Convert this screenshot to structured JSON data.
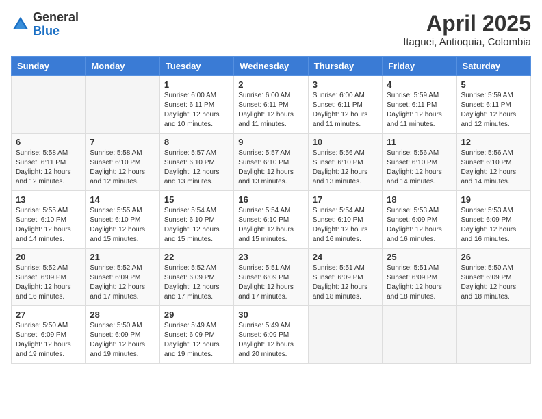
{
  "header": {
    "logo_general": "General",
    "logo_blue": "Blue",
    "month_year": "April 2025",
    "location": "Itaguei, Antioquia, Colombia"
  },
  "weekdays": [
    "Sunday",
    "Monday",
    "Tuesday",
    "Wednesday",
    "Thursday",
    "Friday",
    "Saturday"
  ],
  "weeks": [
    [
      {
        "day": "",
        "info": ""
      },
      {
        "day": "",
        "info": ""
      },
      {
        "day": "1",
        "info": "Sunrise: 6:00 AM\nSunset: 6:11 PM\nDaylight: 12 hours\nand 10 minutes."
      },
      {
        "day": "2",
        "info": "Sunrise: 6:00 AM\nSunset: 6:11 PM\nDaylight: 12 hours\nand 11 minutes."
      },
      {
        "day": "3",
        "info": "Sunrise: 6:00 AM\nSunset: 6:11 PM\nDaylight: 12 hours\nand 11 minutes."
      },
      {
        "day": "4",
        "info": "Sunrise: 5:59 AM\nSunset: 6:11 PM\nDaylight: 12 hours\nand 11 minutes."
      },
      {
        "day": "5",
        "info": "Sunrise: 5:59 AM\nSunset: 6:11 PM\nDaylight: 12 hours\nand 12 minutes."
      }
    ],
    [
      {
        "day": "6",
        "info": "Sunrise: 5:58 AM\nSunset: 6:11 PM\nDaylight: 12 hours\nand 12 minutes."
      },
      {
        "day": "7",
        "info": "Sunrise: 5:58 AM\nSunset: 6:10 PM\nDaylight: 12 hours\nand 12 minutes."
      },
      {
        "day": "8",
        "info": "Sunrise: 5:57 AM\nSunset: 6:10 PM\nDaylight: 12 hours\nand 13 minutes."
      },
      {
        "day": "9",
        "info": "Sunrise: 5:57 AM\nSunset: 6:10 PM\nDaylight: 12 hours\nand 13 minutes."
      },
      {
        "day": "10",
        "info": "Sunrise: 5:56 AM\nSunset: 6:10 PM\nDaylight: 12 hours\nand 13 minutes."
      },
      {
        "day": "11",
        "info": "Sunrise: 5:56 AM\nSunset: 6:10 PM\nDaylight: 12 hours\nand 14 minutes."
      },
      {
        "day": "12",
        "info": "Sunrise: 5:56 AM\nSunset: 6:10 PM\nDaylight: 12 hours\nand 14 minutes."
      }
    ],
    [
      {
        "day": "13",
        "info": "Sunrise: 5:55 AM\nSunset: 6:10 PM\nDaylight: 12 hours\nand 14 minutes."
      },
      {
        "day": "14",
        "info": "Sunrise: 5:55 AM\nSunset: 6:10 PM\nDaylight: 12 hours\nand 15 minutes."
      },
      {
        "day": "15",
        "info": "Sunrise: 5:54 AM\nSunset: 6:10 PM\nDaylight: 12 hours\nand 15 minutes."
      },
      {
        "day": "16",
        "info": "Sunrise: 5:54 AM\nSunset: 6:10 PM\nDaylight: 12 hours\nand 15 minutes."
      },
      {
        "day": "17",
        "info": "Sunrise: 5:54 AM\nSunset: 6:10 PM\nDaylight: 12 hours\nand 16 minutes."
      },
      {
        "day": "18",
        "info": "Sunrise: 5:53 AM\nSunset: 6:09 PM\nDaylight: 12 hours\nand 16 minutes."
      },
      {
        "day": "19",
        "info": "Sunrise: 5:53 AM\nSunset: 6:09 PM\nDaylight: 12 hours\nand 16 minutes."
      }
    ],
    [
      {
        "day": "20",
        "info": "Sunrise: 5:52 AM\nSunset: 6:09 PM\nDaylight: 12 hours\nand 16 minutes."
      },
      {
        "day": "21",
        "info": "Sunrise: 5:52 AM\nSunset: 6:09 PM\nDaylight: 12 hours\nand 17 minutes."
      },
      {
        "day": "22",
        "info": "Sunrise: 5:52 AM\nSunset: 6:09 PM\nDaylight: 12 hours\nand 17 minutes."
      },
      {
        "day": "23",
        "info": "Sunrise: 5:51 AM\nSunset: 6:09 PM\nDaylight: 12 hours\nand 17 minutes."
      },
      {
        "day": "24",
        "info": "Sunrise: 5:51 AM\nSunset: 6:09 PM\nDaylight: 12 hours\nand 18 minutes."
      },
      {
        "day": "25",
        "info": "Sunrise: 5:51 AM\nSunset: 6:09 PM\nDaylight: 12 hours\nand 18 minutes."
      },
      {
        "day": "26",
        "info": "Sunrise: 5:50 AM\nSunset: 6:09 PM\nDaylight: 12 hours\nand 18 minutes."
      }
    ],
    [
      {
        "day": "27",
        "info": "Sunrise: 5:50 AM\nSunset: 6:09 PM\nDaylight: 12 hours\nand 19 minutes."
      },
      {
        "day": "28",
        "info": "Sunrise: 5:50 AM\nSunset: 6:09 PM\nDaylight: 12 hours\nand 19 minutes."
      },
      {
        "day": "29",
        "info": "Sunrise: 5:49 AM\nSunset: 6:09 PM\nDaylight: 12 hours\nand 19 minutes."
      },
      {
        "day": "30",
        "info": "Sunrise: 5:49 AM\nSunset: 6:09 PM\nDaylight: 12 hours\nand 20 minutes."
      },
      {
        "day": "",
        "info": ""
      },
      {
        "day": "",
        "info": ""
      },
      {
        "day": "",
        "info": ""
      }
    ]
  ]
}
